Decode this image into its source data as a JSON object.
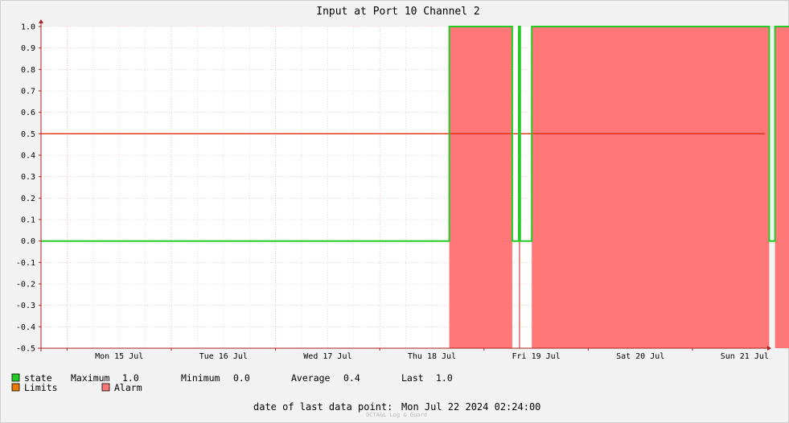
{
  "chart_data": {
    "type": "line",
    "title": "Input at Port 10 Channel 2",
    "xlabel": "",
    "ylabel": "",
    "ylim": [
      -0.5,
      1.0
    ],
    "y_ticks": [
      "1.0",
      "0.9",
      "0.8",
      "0.7",
      "0.6",
      "0.5",
      "0.4",
      "0.3",
      "0.2",
      "0.1",
      "0.0",
      "-0.1",
      "-0.2",
      "-0.3",
      "-0.4",
      "-0.5"
    ],
    "x_ticks": [
      "Mon 15 Jul",
      "Tue 16 Jul",
      "Wed 17 Jul",
      "Thu 18 Jul",
      "Fri 19 Jul",
      "Sat 20 Jul",
      "Sun 21 Jul"
    ],
    "grid": true,
    "limit": 0.5,
    "series": [
      {
        "name": "state",
        "color": "#22cc22",
        "points": [
          [
            "2024-07-14 18:00",
            0
          ],
          [
            "2024-07-18 16:00",
            0
          ],
          [
            "2024-07-18 16:00",
            1
          ],
          [
            "2024-07-19 06:30",
            1
          ],
          [
            "2024-07-19 06:30",
            0
          ],
          [
            "2024-07-19 08:00",
            0
          ],
          [
            "2024-07-19 08:00",
            1
          ],
          [
            "2024-07-19 08:20",
            1
          ],
          [
            "2024-07-19 08:20",
            0
          ],
          [
            "2024-07-19 11:00",
            0
          ],
          [
            "2024-07-19 11:00",
            1
          ],
          [
            "2024-07-21 17:40",
            1
          ],
          [
            "2024-07-21 17:40",
            0
          ],
          [
            "2024-07-21 19:00",
            0
          ],
          [
            "2024-07-21 19:00",
            1
          ],
          [
            "2024-07-22 02:24",
            1
          ]
        ]
      }
    ],
    "alarm_intervals": [
      [
        "2024-07-18 16:00",
        "2024-07-19 06:30"
      ],
      [
        "2024-07-19 08:00",
        "2024-07-19 08:20"
      ],
      [
        "2024-07-19 11:00",
        "2024-07-21 17:40"
      ],
      [
        "2024-07-21 19:00",
        "2024-07-22 02:24"
      ]
    ]
  },
  "legend": {
    "state_label": "state",
    "maximum_label": "Maximum",
    "maximum_value": "1.0",
    "minimum_label": "Minimum",
    "minimum_value": "0.0",
    "average_label": "Average",
    "average_value": "0.4",
    "last_label": "Last",
    "last_value": "1.0",
    "limits_label": "Limits",
    "alarm_label": "Alarm"
  },
  "footer": {
    "last_point_label": "date of last data point:",
    "last_point_value": "Mon Jul 22 2024 02:24:00",
    "watermark": "OCTA&L Log & Guard"
  },
  "colors": {
    "state": "#22cc22",
    "limits": "#ee7700",
    "limit_line": "#e03010",
    "alarm": "#ff7777",
    "grid": "#f0b0b0",
    "axis": "#aa2222"
  }
}
